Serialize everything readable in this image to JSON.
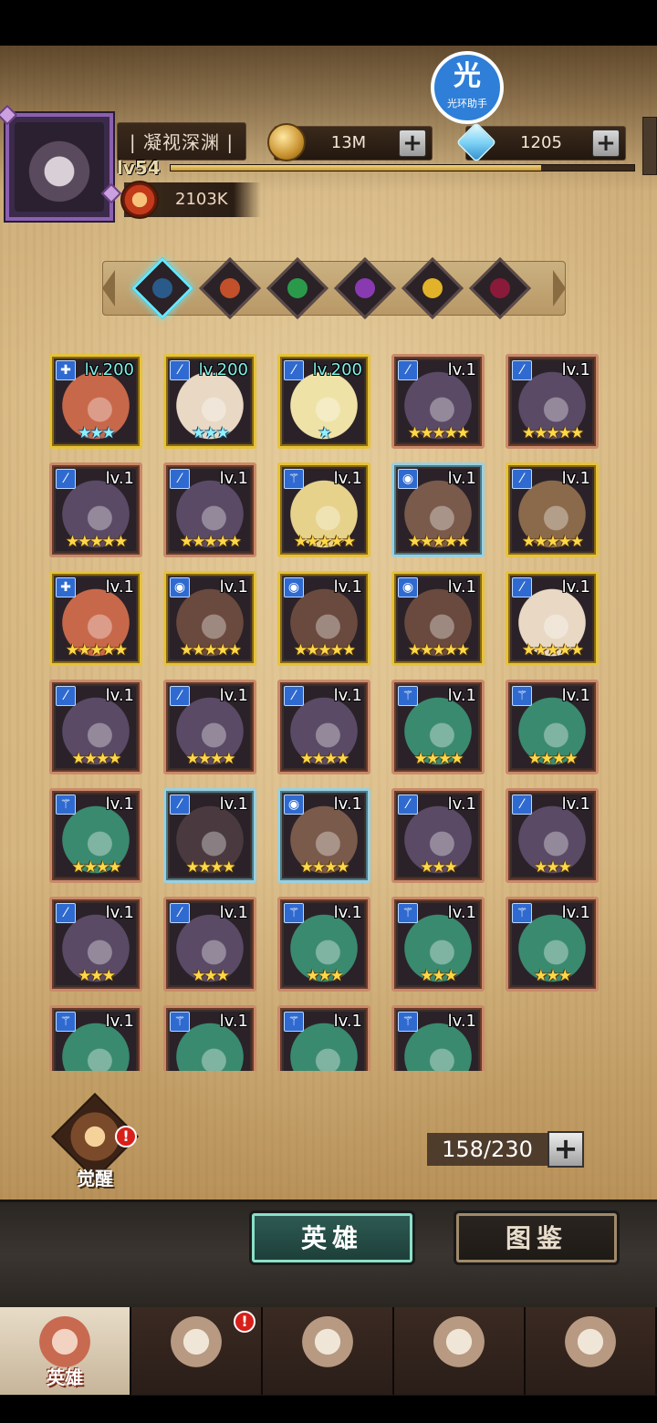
{
  "header": {
    "player_name": "| 凝视深渊 |",
    "level": "lv54",
    "xp_fraction": 0.8,
    "power": "2103K",
    "gold": "13M",
    "gems": "1205",
    "helper_main": "光",
    "helper_sub": "光环助手",
    "plus": "+"
  },
  "filters": {
    "items": [
      {
        "name": "filter-all",
        "active": true,
        "color": "#2a5a8a"
      },
      {
        "name": "filter-fire",
        "active": false,
        "color": "#c2502a"
      },
      {
        "name": "filter-nature",
        "active": false,
        "color": "#2a9a4a"
      },
      {
        "name": "filter-arcane",
        "active": false,
        "color": "#8a3ab0"
      },
      {
        "name": "filter-light",
        "active": false,
        "color": "#e2b22a"
      },
      {
        "name": "filter-dark",
        "active": false,
        "color": "#8a1a3a"
      }
    ]
  },
  "heroes": [
    {
      "lv": "lv.200",
      "stars": "★★★",
      "star_color": "cyan",
      "frame": "gold",
      "cls": "✚",
      "art": "#c8684a"
    },
    {
      "lv": "lv.200",
      "stars": "★★★",
      "star_color": "cyan",
      "frame": "gold",
      "cls": "⁄",
      "art": "#e8d8c4"
    },
    {
      "lv": "lv.200",
      "stars": "★",
      "star_color": "cyan",
      "frame": "gold",
      "cls": "⁄",
      "art": "#efe2a6"
    },
    {
      "lv": "lv.1",
      "stars": "★★★★★",
      "star_color": "gold",
      "frame": "bronze",
      "cls": "⁄",
      "art": "#5a4a66"
    },
    {
      "lv": "lv.1",
      "stars": "★★★★★",
      "star_color": "gold",
      "frame": "bronze",
      "cls": "⁄",
      "art": "#5a4a66"
    },
    {
      "lv": "lv.1",
      "stars": "★★★★★",
      "star_color": "gold",
      "frame": "bronze",
      "cls": "⁄",
      "art": "#5a4a66"
    },
    {
      "lv": "lv.1",
      "stars": "★★★★★",
      "star_color": "gold",
      "frame": "bronze",
      "cls": "⁄",
      "art": "#5a4a66"
    },
    {
      "lv": "lv.1",
      "stars": "★★★★★",
      "star_color": "gold",
      "frame": "gold",
      "cls": "⚚",
      "art": "#e6d28a"
    },
    {
      "lv": "lv.1",
      "stars": "★★★★★",
      "star_color": "gold",
      "frame": "blue",
      "cls": "◉",
      "art": "#7a5a4a"
    },
    {
      "lv": "lv.1",
      "stars": "★★★★★",
      "star_color": "gold",
      "frame": "gold",
      "cls": "⁄",
      "art": "#8a6a4a"
    },
    {
      "lv": "lv.1",
      "stars": "★★★★★",
      "star_color": "gold",
      "frame": "gold",
      "cls": "✚",
      "art": "#c8684a"
    },
    {
      "lv": "lv.1",
      "stars": "★★★★★",
      "star_color": "gold",
      "frame": "gold",
      "cls": "◉",
      "art": "#6a4a3e"
    },
    {
      "lv": "lv.1",
      "stars": "★★★★★",
      "star_color": "gold",
      "frame": "gold",
      "cls": "◉",
      "art": "#6a4a3e"
    },
    {
      "lv": "lv.1",
      "stars": "★★★★★",
      "star_color": "gold",
      "frame": "gold",
      "cls": "◉",
      "art": "#6a4a3e"
    },
    {
      "lv": "lv.1",
      "stars": "★★★★★",
      "star_color": "gold",
      "frame": "gold",
      "cls": "⁄",
      "art": "#e8d8c4"
    },
    {
      "lv": "lv.1",
      "stars": "★★★★",
      "star_color": "gold",
      "frame": "bronze",
      "cls": "⁄",
      "art": "#5a4a66"
    },
    {
      "lv": "lv.1",
      "stars": "★★★★",
      "star_color": "gold",
      "frame": "bronze",
      "cls": "⁄",
      "art": "#5a4a66"
    },
    {
      "lv": "lv.1",
      "stars": "★★★★",
      "star_color": "gold",
      "frame": "bronze",
      "cls": "⁄",
      "art": "#5a4a66"
    },
    {
      "lv": "lv.1",
      "stars": "★★★★",
      "star_color": "gold",
      "frame": "bronze",
      "cls": "⚚",
      "art": "#3a8a70"
    },
    {
      "lv": "lv.1",
      "stars": "★★★★",
      "star_color": "gold",
      "frame": "bronze",
      "cls": "⚚",
      "art": "#3a8a70"
    },
    {
      "lv": "lv.1",
      "stars": "★★★★",
      "star_color": "gold",
      "frame": "bronze",
      "cls": "⚚",
      "art": "#3a8a70"
    },
    {
      "lv": "lv.1",
      "stars": "★★★★",
      "star_color": "gold",
      "frame": "blue",
      "cls": "⁄",
      "art": "#4a3a40"
    },
    {
      "lv": "lv.1",
      "stars": "★★★★",
      "star_color": "gold",
      "frame": "blue",
      "cls": "◉",
      "art": "#7a5a4a"
    },
    {
      "lv": "lv.1",
      "stars": "★★★",
      "star_color": "gold",
      "frame": "bronze",
      "cls": "⁄",
      "art": "#5a4a66"
    },
    {
      "lv": "lv.1",
      "stars": "★★★",
      "star_color": "gold",
      "frame": "bronze",
      "cls": "⁄",
      "art": "#5a4a66"
    },
    {
      "lv": "lv.1",
      "stars": "★★★",
      "star_color": "gold",
      "frame": "bronze",
      "cls": "⁄",
      "art": "#5a4a66"
    },
    {
      "lv": "lv.1",
      "stars": "★★★",
      "star_color": "gold",
      "frame": "bronze",
      "cls": "⁄",
      "art": "#5a4a66"
    },
    {
      "lv": "lv.1",
      "stars": "★★★",
      "star_color": "gold",
      "frame": "bronze",
      "cls": "⚚",
      "art": "#3a8a70"
    },
    {
      "lv": "lv.1",
      "stars": "★★★",
      "star_color": "gold",
      "frame": "bronze",
      "cls": "⚚",
      "art": "#3a8a70"
    },
    {
      "lv": "lv.1",
      "stars": "★★★",
      "star_color": "gold",
      "frame": "bronze",
      "cls": "⚚",
      "art": "#3a8a70"
    },
    {
      "lv": "lv.1",
      "stars": "",
      "star_color": "gold",
      "frame": "bronze",
      "cls": "⚚",
      "art": "#3a8a70"
    },
    {
      "lv": "lv.1",
      "stars": "",
      "star_color": "gold",
      "frame": "bronze",
      "cls": "⚚",
      "art": "#3a8a70"
    },
    {
      "lv": "lv.1",
      "stars": "",
      "star_color": "gold",
      "frame": "bronze",
      "cls": "⚚",
      "art": "#3a8a70"
    },
    {
      "lv": "lv.1",
      "stars": "",
      "star_color": "gold",
      "frame": "bronze",
      "cls": "⚚",
      "art": "#3a8a70"
    }
  ],
  "awaken": {
    "label": "觉醒",
    "badge": "!"
  },
  "capacity": {
    "text": "158/230",
    "plus": "+"
  },
  "segments": {
    "heroes": "英雄",
    "codex": "图鉴"
  },
  "nav": {
    "items": [
      {
        "name": "nav-heroes",
        "label": "英雄",
        "active": true,
        "badge": ""
      },
      {
        "name": "nav-adventure",
        "label": "",
        "active": false,
        "badge": "!"
      },
      {
        "name": "nav-battle",
        "label": "",
        "active": false,
        "badge": ""
      },
      {
        "name": "nav-castle",
        "label": "",
        "active": false,
        "badge": ""
      },
      {
        "name": "nav-guild",
        "label": "",
        "active": false,
        "badge": ""
      }
    ]
  }
}
